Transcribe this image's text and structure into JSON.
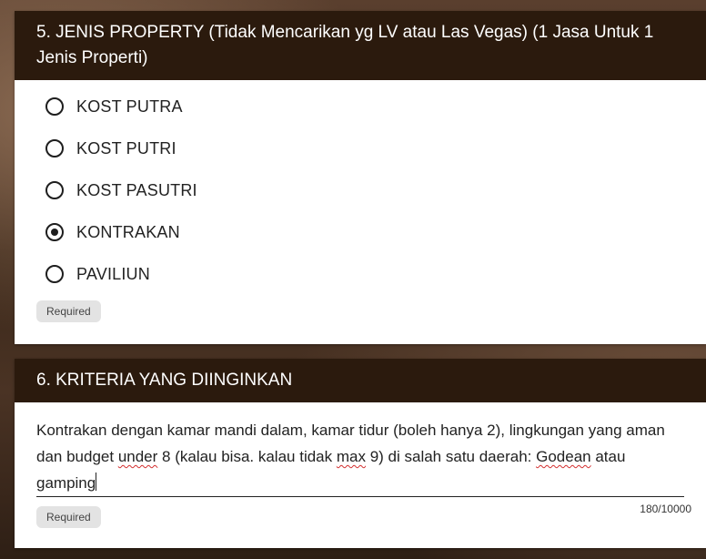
{
  "q5": {
    "title": "5. JENIS PROPERTY (Tidak Mencarikan yg LV atau Las Vegas) (1 Jasa Untuk 1 Jenis Properti)",
    "options": [
      {
        "label": "KOST PUTRA",
        "checked": false
      },
      {
        "label": "KOST PUTRI",
        "checked": false
      },
      {
        "label": "KOST PASUTRI",
        "checked": false
      },
      {
        "label": "KONTRAKAN",
        "checked": true
      },
      {
        "label": "PAVILIUN",
        "checked": false
      }
    ],
    "required": "Required"
  },
  "q6": {
    "title": "6. KRITERIA YANG DIINGINKAN",
    "answer": {
      "part1": "Kontrakan dengan kamar mandi dalam, kamar tidur (boleh hanya 2), lingkungan yang aman dan budget ",
      "w_under": "under",
      "part2": " 8 (kalau bisa. kalau tidak ",
      "w_max": "max",
      "part3": " 9) di salah satu daerah: ",
      "w_godean": "Godean",
      "part4": " atau gamping"
    },
    "counter": "180/10000",
    "required": "Required"
  }
}
